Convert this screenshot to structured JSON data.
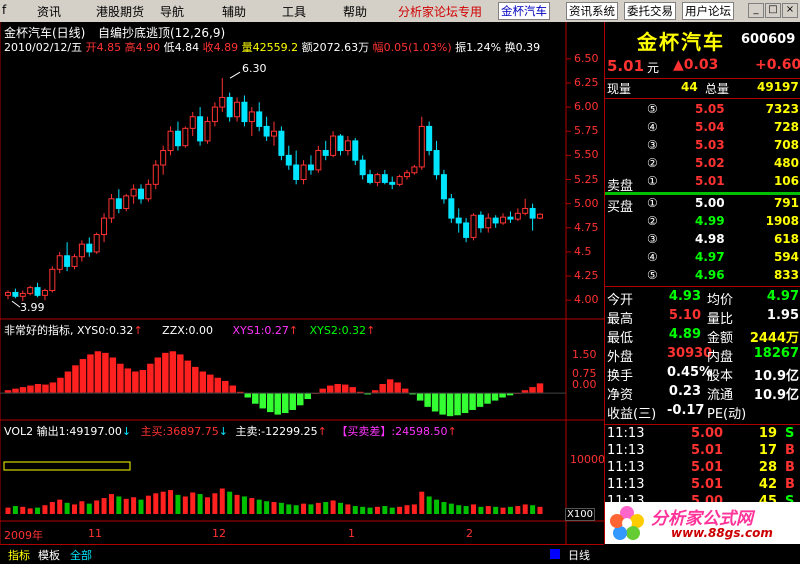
{
  "menu": {
    "items": [
      "f",
      "资讯",
      "港股期货",
      "导航",
      "辅助",
      "工具",
      "帮助"
    ],
    "promo": "分析家论坛专用",
    "buttons": [
      "金杯汽车",
      "资讯系统",
      "委托交易",
      "用户论坛"
    ],
    "window_controls": [
      "_",
      "□",
      "×"
    ]
  },
  "chart": {
    "title": "金杯汽车(日线)",
    "indicator_title": "自编抄底逃顶(12,26,9)",
    "date_label": "2010/02/12/五",
    "ohlc": {
      "open_label": "开",
      "open": "4.85",
      "high_label": "高",
      "high": "4.90",
      "low_label": "低",
      "low": "4.84",
      "close_label": "收",
      "close": "4.89",
      "volume_label": "量",
      "volume": "42559.2",
      "amount_label": "额",
      "amount": "2072.63万",
      "range_label": "幅",
      "range": "0.05(1.03%)",
      "amplitude_label": "振",
      "amplitude": "1.24%",
      "turnover_label": "换",
      "turnover": "0.39"
    },
    "high_marker": "6.30",
    "low_marker": "3.99",
    "price_axis": [
      "6.50",
      "6.25",
      "6.00",
      "5.75",
      "5.50",
      "5.25",
      "5.00",
      "4.75",
      "4.5",
      "4.25",
      "4.00"
    ],
    "indicator2": {
      "title": "非常好的指标,",
      "xys0": "XYS0:0.32",
      "zzx": "ZZX:0.00",
      "xys1": "XYS1:0.27",
      "xys2": "XYS2:0.32",
      "axis": [
        "1.50",
        "0.75",
        "0.00"
      ]
    },
    "volume": {
      "title": "VOL2",
      "output": "输出1:49197.00",
      "main_buy": "主买:36897.75",
      "main_sell": "主卖:-12299.25",
      "diff": "【买卖差】:24598.50",
      "axis_top": "10000",
      "axis_scale": "X100"
    },
    "date_axis": [
      "2009年",
      "11",
      "12",
      "1",
      "2"
    ],
    "period": "日线"
  },
  "chart_data": {
    "type": "candlestick",
    "title": "金杯汽车(日线)",
    "ylim": [
      3.95,
      6.55
    ],
    "candles": [
      [
        4.05,
        4.1,
        4.01,
        4.08
      ],
      [
        4.08,
        4.12,
        4.02,
        4.04
      ],
      [
        4.04,
        4.1,
        3.99,
        4.07
      ],
      [
        4.07,
        4.15,
        4.05,
        4.13
      ],
      [
        4.13,
        4.18,
        4.03,
        4.05
      ],
      [
        4.05,
        4.12,
        4.0,
        4.1
      ],
      [
        4.1,
        4.35,
        4.08,
        4.32
      ],
      [
        4.32,
        4.5,
        4.28,
        4.46
      ],
      [
        4.46,
        4.6,
        4.3,
        4.35
      ],
      [
        4.35,
        4.48,
        4.32,
        4.45
      ],
      [
        4.45,
        4.62,
        4.4,
        4.58
      ],
      [
        4.58,
        4.65,
        4.45,
        4.5
      ],
      [
        4.5,
        4.7,
        4.48,
        4.68
      ],
      [
        4.68,
        4.9,
        4.6,
        4.85
      ],
      [
        4.85,
        5.1,
        4.8,
        5.05
      ],
      [
        5.05,
        5.15,
        4.9,
        4.95
      ],
      [
        4.95,
        5.1,
        4.92,
        5.08
      ],
      [
        5.08,
        5.2,
        5.0,
        5.15
      ],
      [
        5.15,
        5.2,
        5.0,
        5.05
      ],
      [
        5.05,
        5.25,
        5.02,
        5.2
      ],
      [
        5.2,
        5.45,
        5.15,
        5.4
      ],
      [
        5.4,
        5.6,
        5.3,
        5.55
      ],
      [
        5.55,
        5.8,
        5.5,
        5.75
      ],
      [
        5.75,
        5.85,
        5.55,
        5.6
      ],
      [
        5.6,
        5.8,
        5.58,
        5.78
      ],
      [
        5.78,
        5.95,
        5.7,
        5.9
      ],
      [
        5.9,
        6.0,
        5.6,
        5.65
      ],
      [
        5.65,
        5.9,
        5.62,
        5.85
      ],
      [
        5.85,
        6.05,
        5.8,
        6.0
      ],
      [
        6.0,
        6.3,
        5.95,
        6.1
      ],
      [
        6.1,
        6.15,
        5.85,
        5.9
      ],
      [
        5.9,
        6.1,
        5.85,
        6.05
      ],
      [
        6.05,
        6.12,
        5.8,
        5.85
      ],
      [
        5.85,
        6.0,
        5.7,
        5.95
      ],
      [
        5.95,
        6.05,
        5.75,
        5.8
      ],
      [
        5.8,
        5.9,
        5.65,
        5.7
      ],
      [
        5.7,
        5.85,
        5.6,
        5.75
      ],
      [
        5.75,
        5.8,
        5.45,
        5.5
      ],
      [
        5.5,
        5.6,
        5.35,
        5.4
      ],
      [
        5.4,
        5.55,
        5.2,
        5.25
      ],
      [
        5.25,
        5.45,
        5.2,
        5.4
      ],
      [
        5.4,
        5.5,
        5.3,
        5.35
      ],
      [
        5.35,
        5.6,
        5.32,
        5.55
      ],
      [
        5.55,
        5.65,
        5.45,
        5.5
      ],
      [
        5.5,
        5.75,
        5.48,
        5.7
      ],
      [
        5.7,
        5.72,
        5.5,
        5.55
      ],
      [
        5.55,
        5.7,
        5.5,
        5.65
      ],
      [
        5.65,
        5.68,
        5.4,
        5.45
      ],
      [
        5.45,
        5.5,
        5.25,
        5.3
      ],
      [
        5.3,
        5.35,
        5.2,
        5.22
      ],
      [
        5.22,
        5.32,
        5.18,
        5.3
      ],
      [
        5.3,
        5.35,
        5.2,
        5.22
      ],
      [
        5.22,
        5.28,
        5.15,
        5.2
      ],
      [
        5.2,
        5.3,
        5.18,
        5.28
      ],
      [
        5.28,
        5.35,
        5.25,
        5.32
      ],
      [
        5.32,
        5.4,
        5.3,
        5.38
      ],
      [
        5.38,
        5.9,
        5.35,
        5.8
      ],
      [
        5.8,
        5.85,
        5.5,
        5.55
      ],
      [
        5.55,
        5.65,
        5.25,
        5.3
      ],
      [
        5.3,
        5.35,
        5.0,
        5.05
      ],
      [
        5.05,
        5.1,
        4.8,
        4.85
      ],
      [
        4.85,
        4.95,
        4.7,
        4.8
      ],
      [
        4.8,
        4.85,
        4.6,
        4.65
      ],
      [
        4.65,
        4.9,
        4.62,
        4.88
      ],
      [
        4.88,
        4.92,
        4.7,
        4.75
      ],
      [
        4.75,
        4.9,
        4.7,
        4.85
      ],
      [
        4.85,
        4.88,
        4.75,
        4.8
      ],
      [
        4.8,
        4.9,
        4.78,
        4.86
      ],
      [
        4.86,
        4.92,
        4.8,
        4.84
      ],
      [
        4.84,
        4.95,
        4.82,
        4.9
      ],
      [
        4.9,
        5.05,
        4.88,
        4.95
      ],
      [
        4.95,
        5.0,
        4.72,
        4.85
      ],
      [
        4.85,
        4.9,
        4.84,
        4.89
      ]
    ],
    "indicator_ylim": [
      -0.8,
      1.8
    ],
    "indicator_values": [
      0.1,
      0.15,
      0.2,
      0.25,
      0.3,
      0.28,
      0.35,
      0.5,
      0.7,
      0.9,
      1.1,
      1.25,
      1.35,
      1.3,
      1.15,
      0.95,
      0.8,
      0.7,
      0.75,
      0.95,
      1.15,
      1.3,
      1.35,
      1.25,
      1.05,
      0.85,
      0.7,
      0.6,
      0.5,
      0.4,
      0.25,
      0.05,
      -0.15,
      -0.35,
      -0.5,
      -0.62,
      -0.7,
      -0.65,
      -0.55,
      -0.4,
      -0.2,
      0.0,
      0.15,
      0.25,
      0.3,
      0.28,
      0.2,
      0.05,
      -0.05,
      0.1,
      0.3,
      0.45,
      0.35,
      0.15,
      -0.05,
      -0.25,
      -0.45,
      -0.6,
      -0.7,
      -0.75,
      -0.72,
      -0.65,
      -0.55,
      -0.45,
      -0.35,
      -0.25,
      -0.15,
      -0.08,
      0.0,
      0.1,
      0.2,
      0.32
    ],
    "volume_values": [
      8,
      10,
      9,
      7,
      8,
      11,
      15,
      18,
      14,
      12,
      16,
      13,
      17,
      20,
      25,
      22,
      19,
      21,
      18,
      23,
      26,
      28,
      30,
      24,
      22,
      27,
      25,
      21,
      26,
      32,
      28,
      24,
      22,
      20,
      18,
      16,
      15,
      14,
      12,
      11,
      13,
      12,
      14,
      15,
      17,
      14,
      12,
      10,
      9,
      8,
      9,
      10,
      8,
      9,
      11,
      12,
      28,
      22,
      18,
      15,
      13,
      11,
      10,
      12,
      9,
      10,
      9,
      8,
      9,
      10,
      12,
      11,
      9
    ]
  },
  "quote": {
    "name": "金杯汽车",
    "code": "600609",
    "price": "5.01",
    "price_unit": "元",
    "change": "▲0.03",
    "change_pct": "+0.60",
    "now_vol_label": "现量",
    "now_vol": "44",
    "total_vol_label": "总量",
    "total_vol": "49197",
    "asks": [
      {
        "level": "⑤",
        "price": "5.05",
        "vol": "7323"
      },
      {
        "level": "④",
        "price": "5.04",
        "vol": "728"
      },
      {
        "level": "③",
        "price": "5.03",
        "vol": "708"
      },
      {
        "level": "②",
        "price": "5.02",
        "vol": "480"
      },
      {
        "level": "①",
        "price": "5.01",
        "vol": "106"
      }
    ],
    "bids": [
      {
        "level": "①",
        "price": "5.00",
        "vol": "791"
      },
      {
        "level": "②",
        "price": "4.99",
        "vol": "1908"
      },
      {
        "level": "③",
        "price": "4.98",
        "vol": "618"
      },
      {
        "level": "④",
        "price": "4.97",
        "vol": "594"
      },
      {
        "level": "⑤",
        "price": "4.96",
        "vol": "833"
      }
    ],
    "ask_label": "卖盘",
    "bid_label": "买盘",
    "stats": [
      {
        "l1": "今开",
        "v1": "4.93",
        "l2": "均价",
        "v2": "4.97"
      },
      {
        "l1": "最高",
        "v1": "5.10",
        "l2": "量比",
        "v2": "1.95"
      },
      {
        "l1": "最低",
        "v1": "4.89",
        "l2": "金额",
        "v2": "2444万"
      },
      {
        "l1": "外盘",
        "v1": "30930",
        "l2": "内盘",
        "v2": "18267"
      },
      {
        "l1": "换手",
        "v1": "0.45%",
        "l2": "股本",
        "v2": "10.9亿"
      },
      {
        "l1": "净资",
        "v1": "0.23",
        "l2": "流通",
        "v2": "10.9亿"
      },
      {
        "l1": "收益(三)",
        "v1": "-0.17",
        "l2": "PE(动)",
        "v2": ""
      }
    ],
    "ticks": [
      {
        "time": "11:13",
        "price": "5.00",
        "vol": "19",
        "side": "S"
      },
      {
        "time": "11:13",
        "price": "5.01",
        "vol": "17",
        "side": "B"
      },
      {
        "time": "11:13",
        "price": "5.01",
        "vol": "28",
        "side": "B"
      },
      {
        "time": "11:13",
        "price": "5.01",
        "vol": "42",
        "side": "B"
      },
      {
        "time": "11:13",
        "price": "5.00",
        "vol": "45",
        "side": "S"
      }
    ],
    "watermark": "分析家公式网",
    "watermark_url": "www.88gs.com"
  },
  "bottom_tabs": [
    "指标",
    "模板",
    "全部"
  ],
  "colors": {
    "up": "#ff3232",
    "down": "#00e5ff",
    "green": "#00ff00",
    "axis": "#b00000",
    "yellow": "#ffff00"
  }
}
